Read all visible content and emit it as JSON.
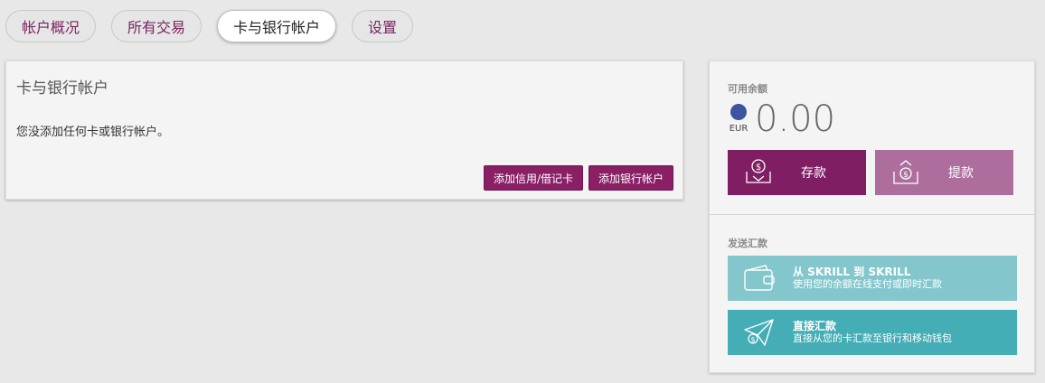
{
  "tabs": [
    {
      "label": "帐户概况"
    },
    {
      "label": "所有交易"
    },
    {
      "label": "卡与银行帐户"
    },
    {
      "label": "设置"
    }
  ],
  "cards_panel": {
    "title": "卡与银行帐户",
    "empty_message": "您没添加任何卡或银行帐户。",
    "add_card_label": "添加信用/借记卡",
    "add_bank_label": "添加银行帐户"
  },
  "balance": {
    "label": "可用余额",
    "currency": "EUR",
    "amount": "0.00",
    "deposit_label": "存款",
    "withdraw_label": "提款"
  },
  "send": {
    "label": "发送汇款",
    "skrill_title": "从 SKRILL 到 SKRILL",
    "skrill_desc": "使用您的余额在线支付或即时汇款",
    "direct_title": "直接汇款",
    "direct_desc": "直接从您的卡汇款至银行和移动钱包"
  },
  "colors": {
    "brand": "#8a1f66",
    "withdraw": "#ad6e9d",
    "skrill_to_skrill": "#83c7cc",
    "direct": "#44adb5",
    "currency_dot": "#3d55a0"
  }
}
